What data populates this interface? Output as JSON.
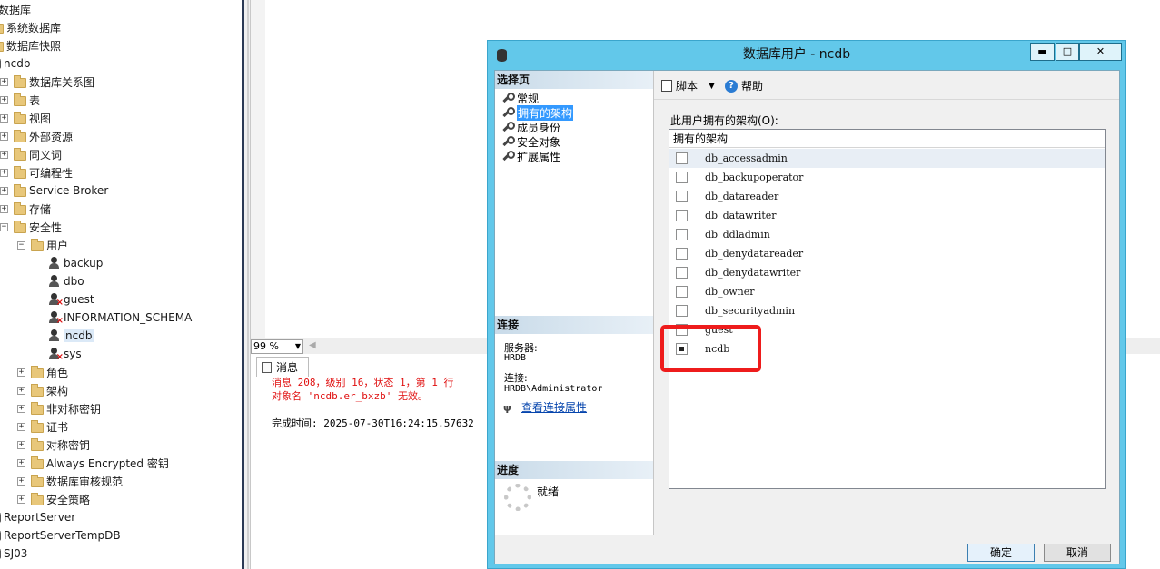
{
  "tree": {
    "items": [
      {
        "label": "数据库",
        "indent": 0,
        "expander": "",
        "icon": "none"
      },
      {
        "label": "系统数据库",
        "indent": 1,
        "expander": "",
        "icon": "folder"
      },
      {
        "label": "数据库快照",
        "indent": 1,
        "expander": "",
        "icon": "folder"
      },
      {
        "label": "ncdb",
        "indent": 1,
        "expander": "",
        "icon": "database"
      },
      {
        "label": "数据库关系图",
        "indent": 2,
        "expander": "+",
        "icon": "folder"
      },
      {
        "label": "表",
        "indent": 2,
        "expander": "+",
        "icon": "folder"
      },
      {
        "label": "视图",
        "indent": 2,
        "expander": "+",
        "icon": "folder"
      },
      {
        "label": "外部资源",
        "indent": 2,
        "expander": "+",
        "icon": "folder"
      },
      {
        "label": "同义词",
        "indent": 2,
        "expander": "+",
        "icon": "folder"
      },
      {
        "label": "可编程性",
        "indent": 2,
        "expander": "+",
        "icon": "folder"
      },
      {
        "label": "Service Broker",
        "indent": 2,
        "expander": "+",
        "icon": "folder"
      },
      {
        "label": "存储",
        "indent": 2,
        "expander": "+",
        "icon": "folder"
      },
      {
        "label": "安全性",
        "indent": 2,
        "expander": "−",
        "icon": "folder"
      },
      {
        "label": "用户",
        "indent": 3,
        "expander": "−",
        "icon": "folder"
      },
      {
        "label": "backup",
        "indent": 4,
        "expander": "",
        "icon": "user"
      },
      {
        "label": "dbo",
        "indent": 4,
        "expander": "",
        "icon": "user"
      },
      {
        "label": "guest",
        "indent": 4,
        "expander": "",
        "icon": "user-disabled"
      },
      {
        "label": "INFORMATION_SCHEMA",
        "indent": 4,
        "expander": "",
        "icon": "user-disabled"
      },
      {
        "label": "ncdb",
        "indent": 4,
        "expander": "",
        "icon": "user",
        "selected": true
      },
      {
        "label": "sys",
        "indent": 4,
        "expander": "",
        "icon": "user-disabled"
      },
      {
        "label": "角色",
        "indent": 3,
        "expander": "+",
        "icon": "folder"
      },
      {
        "label": "架构",
        "indent": 3,
        "expander": "+",
        "icon": "folder"
      },
      {
        "label": "非对称密钥",
        "indent": 3,
        "expander": "+",
        "icon": "folder"
      },
      {
        "label": "证书",
        "indent": 3,
        "expander": "+",
        "icon": "folder"
      },
      {
        "label": "对称密钥",
        "indent": 3,
        "expander": "+",
        "icon": "folder"
      },
      {
        "label": "Always Encrypted 密钥",
        "indent": 3,
        "expander": "+",
        "icon": "folder"
      },
      {
        "label": "数据库审核规范",
        "indent": 3,
        "expander": "+",
        "icon": "folder"
      },
      {
        "label": "安全策略",
        "indent": 3,
        "expander": "+",
        "icon": "folder"
      },
      {
        "label": "ReportServer",
        "indent": 1,
        "expander": "",
        "icon": "database"
      },
      {
        "label": "ReportServerTempDB",
        "indent": 1,
        "expander": "",
        "icon": "database"
      },
      {
        "label": "SJ03",
        "indent": 1,
        "expander": "",
        "icon": "database"
      }
    ]
  },
  "editor": {
    "zoom": "99 %",
    "results_tab": "消息",
    "messages": [
      {
        "text": "消息 208，级别 16，状态 1，第 1 行",
        "kind": "err"
      },
      {
        "text": "对象名 'ncdb.er_bxzb' 无效。",
        "kind": "err"
      },
      {
        "text": "",
        "kind": "ok"
      },
      {
        "text": "完成时间: 2025-07-30T16:24:15.57632",
        "kind": "ok"
      }
    ]
  },
  "dialog": {
    "title": "数据库用户 - ncdb",
    "window_buttons": {
      "minimize": "▬",
      "maximize": "□",
      "close": "✕"
    },
    "left": {
      "select_page_header": "选择页",
      "pages": [
        "常规",
        "拥有的架构",
        "成员身份",
        "安全对象",
        "扩展属性"
      ],
      "active_page_index": 1,
      "connection_header": "连接",
      "server_label": "服务器:",
      "server_value": "HRDB",
      "connection_label": "连接:",
      "connection_value": "HRDB\\Administrator",
      "view_connection_link": "查看连接属性",
      "progress_header": "进度",
      "progress_status": "就绪"
    },
    "toolbar": {
      "script_label": "脚本",
      "help_label": "帮助"
    },
    "schemas_label": "此用户拥有的架构(O):",
    "grid_header": "拥有的架构",
    "schemas": [
      {
        "name": "db_accessadmin",
        "checked": false
      },
      {
        "name": "db_backupoperator",
        "checked": false
      },
      {
        "name": "db_datareader",
        "checked": false
      },
      {
        "name": "db_datawriter",
        "checked": false
      },
      {
        "name": "db_ddladmin",
        "checked": false
      },
      {
        "name": "db_denydatareader",
        "checked": false
      },
      {
        "name": "db_denydatawriter",
        "checked": false
      },
      {
        "name": "db_owner",
        "checked": false
      },
      {
        "name": "db_securityadmin",
        "checked": false
      },
      {
        "name": "guest",
        "checked": false
      },
      {
        "name": "ncdb",
        "checked": true
      }
    ],
    "ok_label": "确定",
    "cancel_label": "取消"
  },
  "colors": {
    "dialog_frame": "#62c8ea",
    "highlight_box": "#ee1c1c",
    "error_text": "#e01010",
    "selection": "#3399ff"
  }
}
